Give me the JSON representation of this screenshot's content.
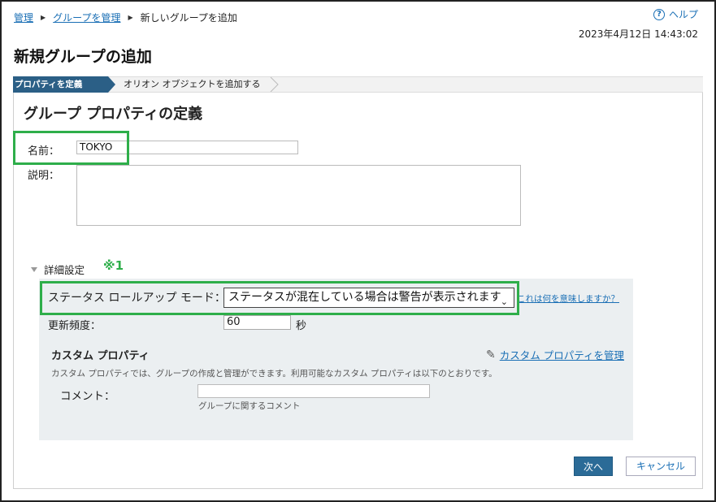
{
  "breadcrumb": {
    "items": [
      "管理",
      "グループを管理"
    ],
    "current": "新しいグループを追加"
  },
  "header": {
    "help_label": "ヘルプ",
    "timestamp": "2023年4月12日 14:43:02",
    "page_title": "新規グループの追加"
  },
  "wizard": {
    "steps": [
      {
        "label": "プロパティを定義",
        "active": true
      },
      {
        "label": "オリオン オブジェクトを追加する",
        "active": false
      }
    ]
  },
  "form": {
    "section_title": "グループ プロパティの定義",
    "name_label": "名前：",
    "name_value": "TOKYO",
    "description_label": "説明：",
    "description_value": ""
  },
  "advanced": {
    "toggle_label": "詳細設定",
    "note_mark": "※1",
    "rollup_label": "ステータス ロールアップ モード：",
    "rollup_value": "ステータスが混在している場合は警告が表示されます",
    "rollup_help_link": "これは何を意味しますか？",
    "frequency_label": "更新頻度：",
    "frequency_value": "60",
    "frequency_unit": "秒",
    "custom_title": "カスタム プロパティ",
    "manage_link": "カスタム プロパティを管理",
    "custom_description": "カスタム プロパティでは、グループの作成と管理ができます。利用可能なカスタム プロパティは以下のとおりです。",
    "comment_label": "コメント：",
    "comment_value": "",
    "comment_hint": "グループに関するコメント"
  },
  "buttons": {
    "next": "次へ",
    "cancel": "キャンセル"
  },
  "colors": {
    "accent": "#2b5f86",
    "highlight": "#2eae4a",
    "link": "#1a6fb5"
  }
}
